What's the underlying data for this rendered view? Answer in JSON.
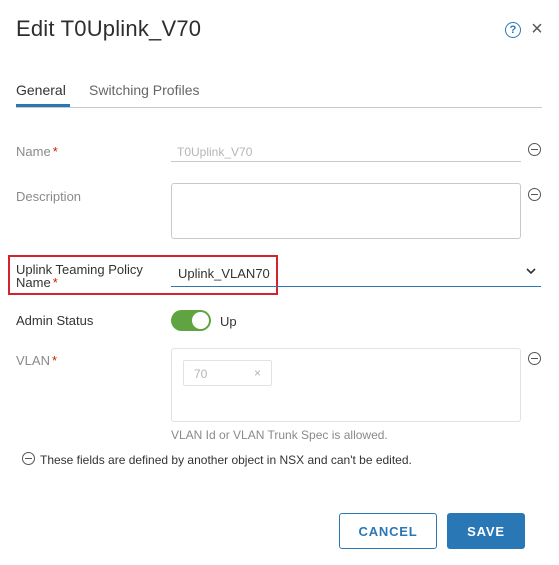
{
  "dialog": {
    "title": "Edit T0Uplink_V70"
  },
  "tabs": [
    {
      "label": "General",
      "active": true
    },
    {
      "label": "Switching Profiles",
      "active": false
    }
  ],
  "form": {
    "name": {
      "label": "Name",
      "required_mark": "*",
      "value": "T0Uplink_V70"
    },
    "description": {
      "label": "Description",
      "value": ""
    },
    "uplink_teaming_policy": {
      "label_line1": "Uplink Teaming Policy",
      "label_line2": "Name",
      "required_mark": "*",
      "value": "Uplink_VLAN70"
    },
    "admin_status": {
      "label": "Admin Status",
      "value": "Up",
      "enabled": true
    },
    "vlan": {
      "label": "VLAN",
      "required_mark": "*",
      "chip_value": "70",
      "chip_remove": "×",
      "helper": "VLAN Id or VLAN Trunk Spec is allowed."
    }
  },
  "footnote": "These fields are defined by another object in NSX and can't be edited.",
  "buttons": {
    "cancel": "CANCEL",
    "save": "SAVE"
  },
  "colors": {
    "accent": "#2a77b6",
    "toggle_on": "#60a442",
    "required": "#c92100",
    "highlight": "#d3232f"
  },
  "icons": {
    "help": "help-circle-icon",
    "close": "close-icon",
    "locked": "lock-minus-circle-icon",
    "dropdown": "chevron-down-icon"
  }
}
